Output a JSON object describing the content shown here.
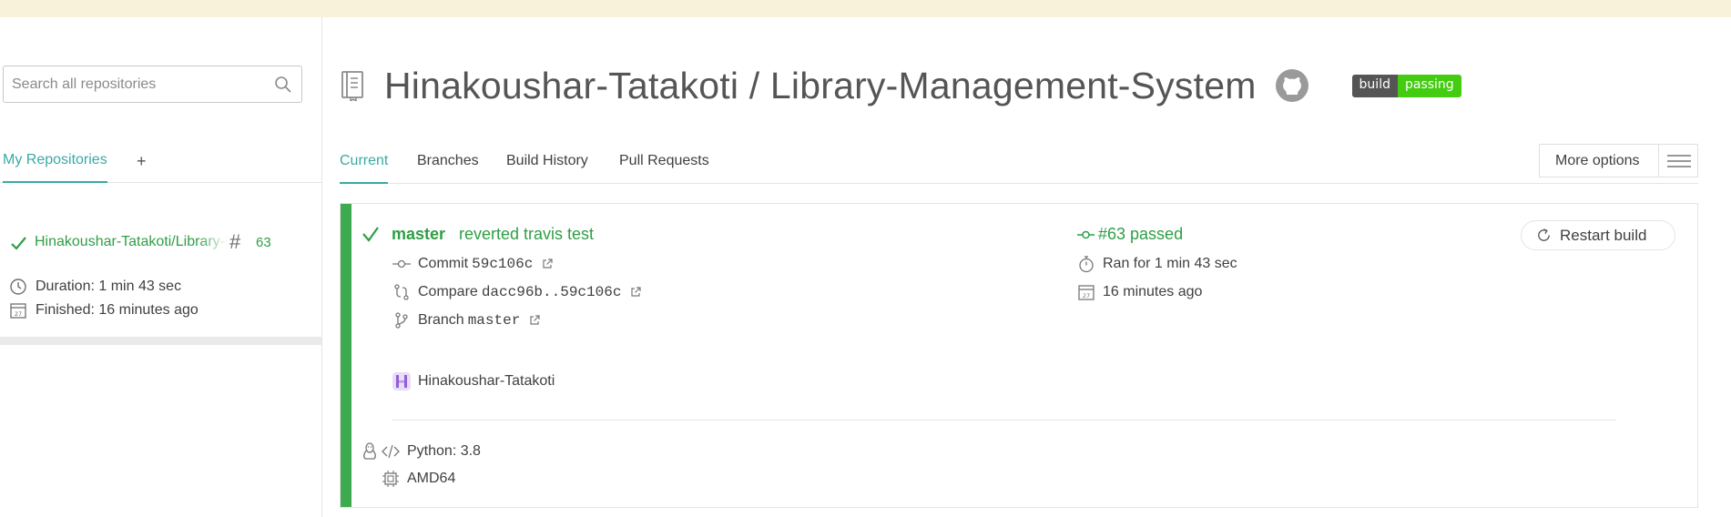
{
  "sidebar": {
    "search_placeholder": "Search all repositories",
    "tab_label": "My Repositories",
    "add_label": "+",
    "repo": {
      "name": "Hinakoushar-Tatakoti/Library-Management-System",
      "hash": "#",
      "build_number": "63",
      "duration": "Duration: 1 min 43 sec",
      "finished": "Finished: 16 minutes ago",
      "status": "passed"
    }
  },
  "header": {
    "title": "Hinakoushar-Tatakoti / Library-Management-System",
    "badge_left": "build",
    "badge_right": "passing"
  },
  "tabs": [
    "Current",
    "Branches",
    "Build History",
    "Pull Requests"
  ],
  "more_options": "More options",
  "build": {
    "branch": "master",
    "message": "reverted travis test",
    "status": "#63 passed",
    "restart_label": "Restart build",
    "commit_label": "Commit",
    "commit_sha": "59c106c",
    "compare_label": "Compare",
    "compare_range": "dacc96b..59c106c",
    "branch_label": "Branch",
    "branch_value": "master",
    "ran_for": "Ran for 1 min 43 sec",
    "finished_ago": "16 minutes ago",
    "author": "Hinakoushar-Tatakoti",
    "language": "Python: 3.8",
    "arch": "AMD64"
  },
  "colors": {
    "passed_green": "#2f9e46",
    "stripe_green": "#3eaa4f",
    "accent_teal": "#39aaa4",
    "banner": "#f9f2da"
  }
}
